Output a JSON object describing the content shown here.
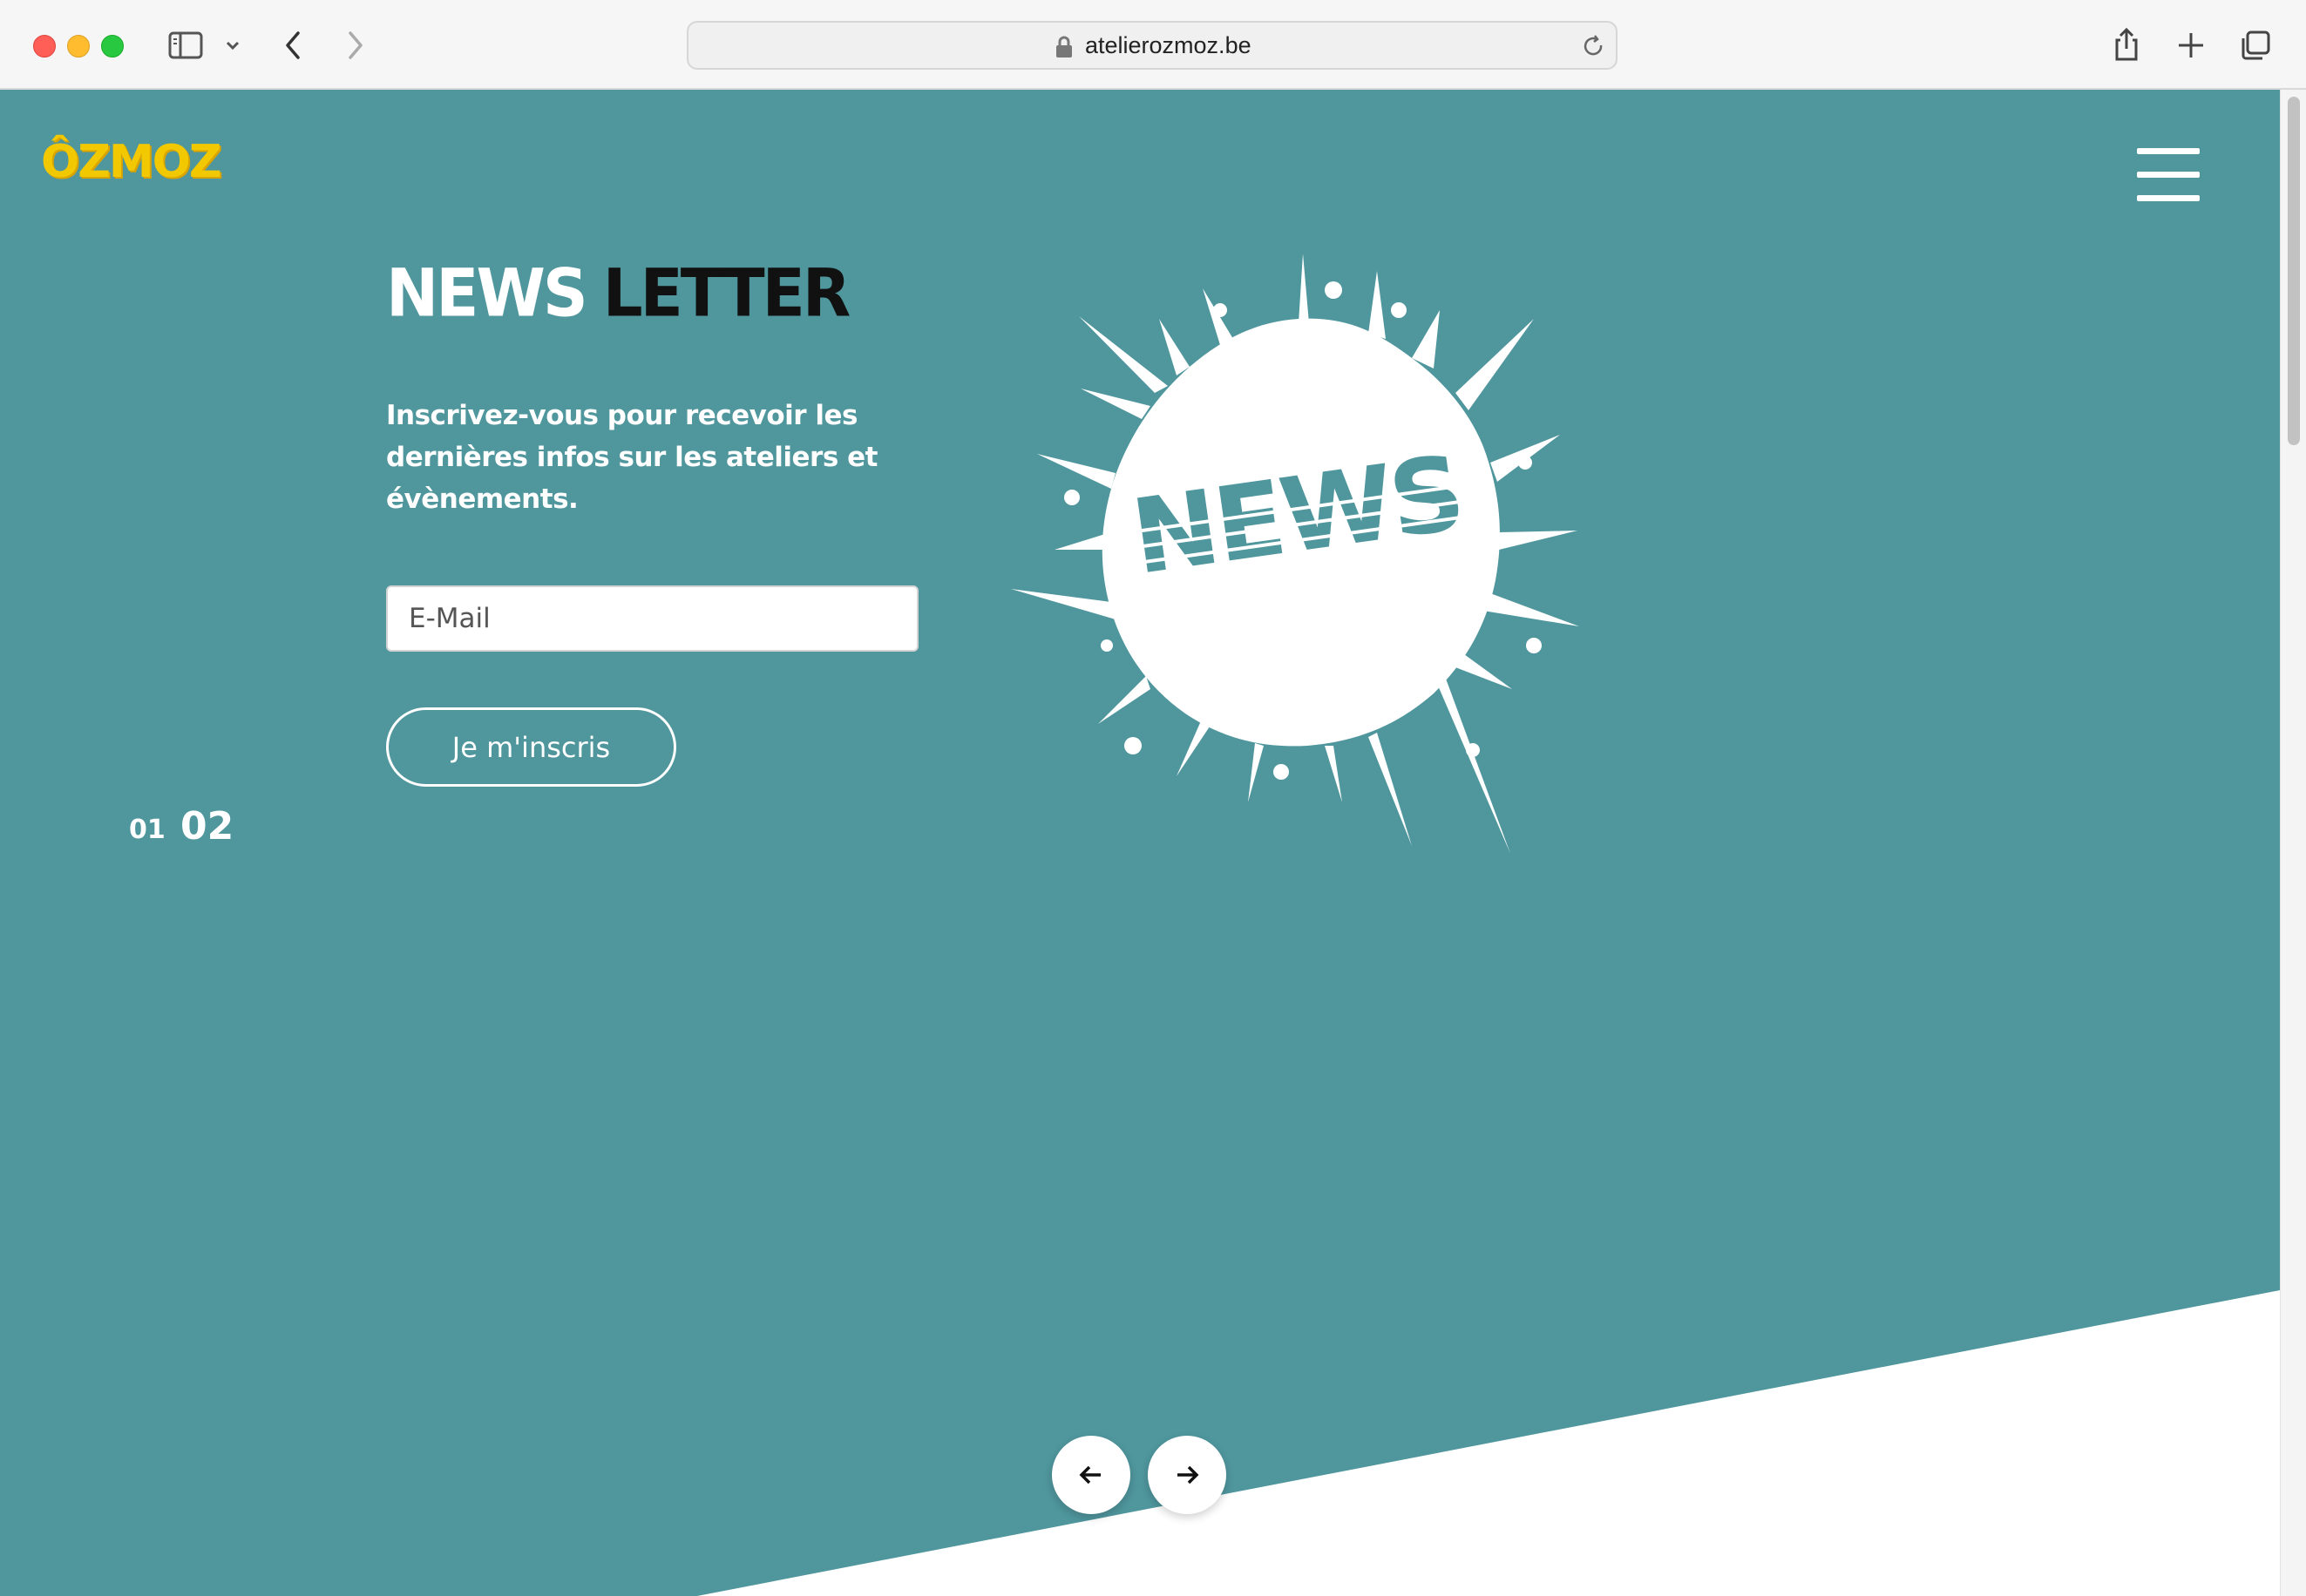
{
  "browser": {
    "url": "atelierozmoz.be"
  },
  "site": {
    "logo": "ÔZMOZ"
  },
  "hero": {
    "title_part1": "NEWS",
    "title_part2": "LETTER",
    "description": "Inscrivez-vous pour recevoir les dernières infos sur les ateliers et évènements.",
    "email_placeholder": "E-Mail",
    "subscribe_label": "Je m'inscris",
    "illustration_text": "NEWS"
  },
  "slider": {
    "pager": [
      "01",
      "02"
    ],
    "active_index": 2
  },
  "colors": {
    "background": "#4f969d",
    "logo": "#f2c900",
    "title_accent": "#111111"
  }
}
